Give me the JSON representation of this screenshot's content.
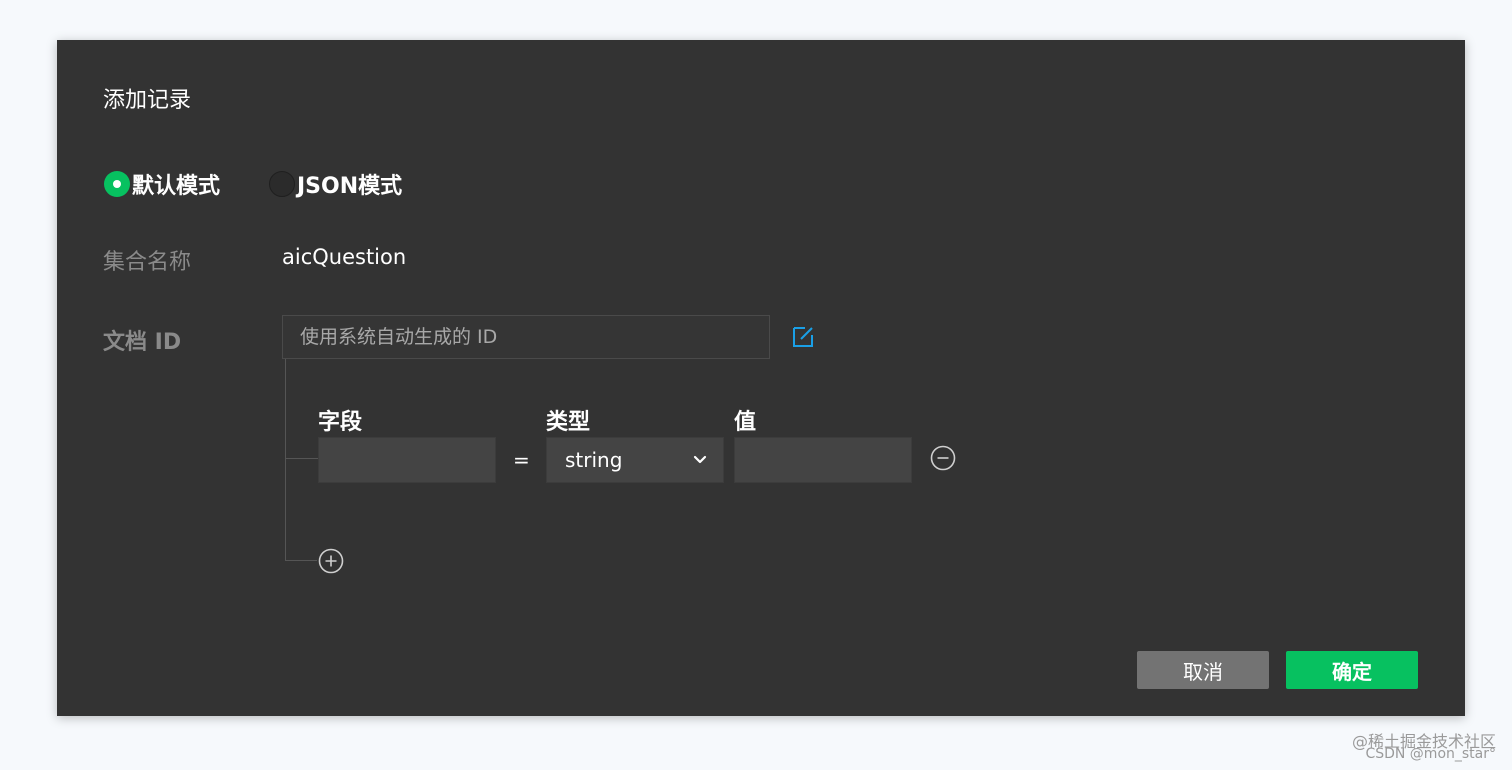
{
  "dialog": {
    "title": "添加记录",
    "modes": [
      {
        "label": "默认模式",
        "selected": true
      },
      {
        "label": "JSON模式",
        "selected": false
      }
    ],
    "collection": {
      "label": "集合名称",
      "value": "aicQuestion"
    },
    "doc_id": {
      "label": "文档 ID",
      "placeholder": "使用系统自动生成的 ID"
    },
    "fields": {
      "headers": {
        "field": "字段",
        "type": "类型",
        "value": "值"
      },
      "rows": [
        {
          "field": "",
          "equals": "=",
          "type": "string",
          "value": ""
        }
      ]
    },
    "buttons": {
      "cancel": "取消",
      "confirm": "确定"
    },
    "colors": {
      "accent": "#07c160",
      "link": "#1a9fe6",
      "background": "#333333"
    },
    "icons": [
      "edit-icon",
      "chevron-down-icon",
      "minus-circle-icon",
      "plus-circle-icon"
    ]
  },
  "watermark": {
    "line1": "@稀土掘金技术社区",
    "line2": "CSDN @mon_star°"
  }
}
